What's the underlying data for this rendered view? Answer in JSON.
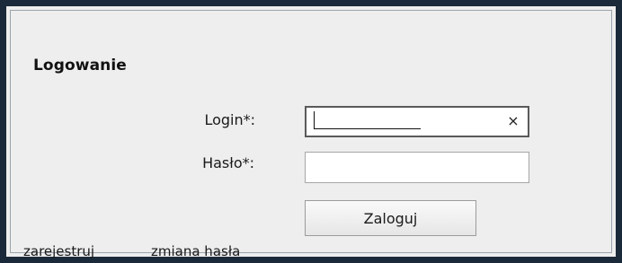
{
  "form": {
    "title": "Logowanie",
    "login_label": "Login*:",
    "login_value": "",
    "password_label": "Hasło*:",
    "password_value": "",
    "clear_glyph": "×",
    "submit_label": "Zaloguj"
  },
  "footer": {
    "register_link": "zarejestruj",
    "change_password_link": "zmiana hasła"
  },
  "colors": {
    "frame": "#1b2a3a",
    "panel_background": "#eeeeee",
    "input_background": "#ffffff"
  },
  "icons": {
    "clear": "close-icon"
  }
}
